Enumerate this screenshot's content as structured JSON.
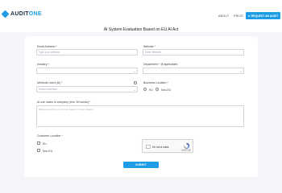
{
  "header": {
    "logo_prefix": "AUDIT",
    "logo_suffix": "ONE",
    "nav": [
      {
        "label": "ABOUT"
      },
      {
        "label": "PRICE"
      }
    ],
    "cta_label": "REQUEST AN AUDIT",
    "cta_icon": "send-icon"
  },
  "page": {
    "title": "AI System Evaluation Based on EU AI Act"
  },
  "form": {
    "email": {
      "label": "Email Address *",
      "placeholder": "Type your address"
    },
    "website": {
      "label": "Website *",
      "placeholder": "Enter Website"
    },
    "industry": {
      "label": "Industry *",
      "value": ""
    },
    "department": {
      "label": "Department * (if applicable)",
      "value": ""
    },
    "methods": {
      "label": "Methods Used (AI) *",
      "placeholder": "Select a Method"
    },
    "business_location": {
      "label": "Business Location *",
      "options": [
        "EU",
        "Non-EU"
      ]
    },
    "use_cases": {
      "label": "AI use cases in company (min. 50 words) *",
      "placeholder": "Please describe your AI use cases, in short details..."
    },
    "customer_location": {
      "label": "Customer Location *",
      "options": [
        "EU",
        "Non-EU"
      ]
    },
    "captcha": {
      "label": "I'm not a robot",
      "brand": "reCAPTCHA",
      "links": "Privacy - Terms"
    },
    "submit_label": "SUBMIT"
  },
  "colors": {
    "accent": "#1e9de6",
    "background": "#f4f6fa",
    "card": "#ffffff"
  }
}
